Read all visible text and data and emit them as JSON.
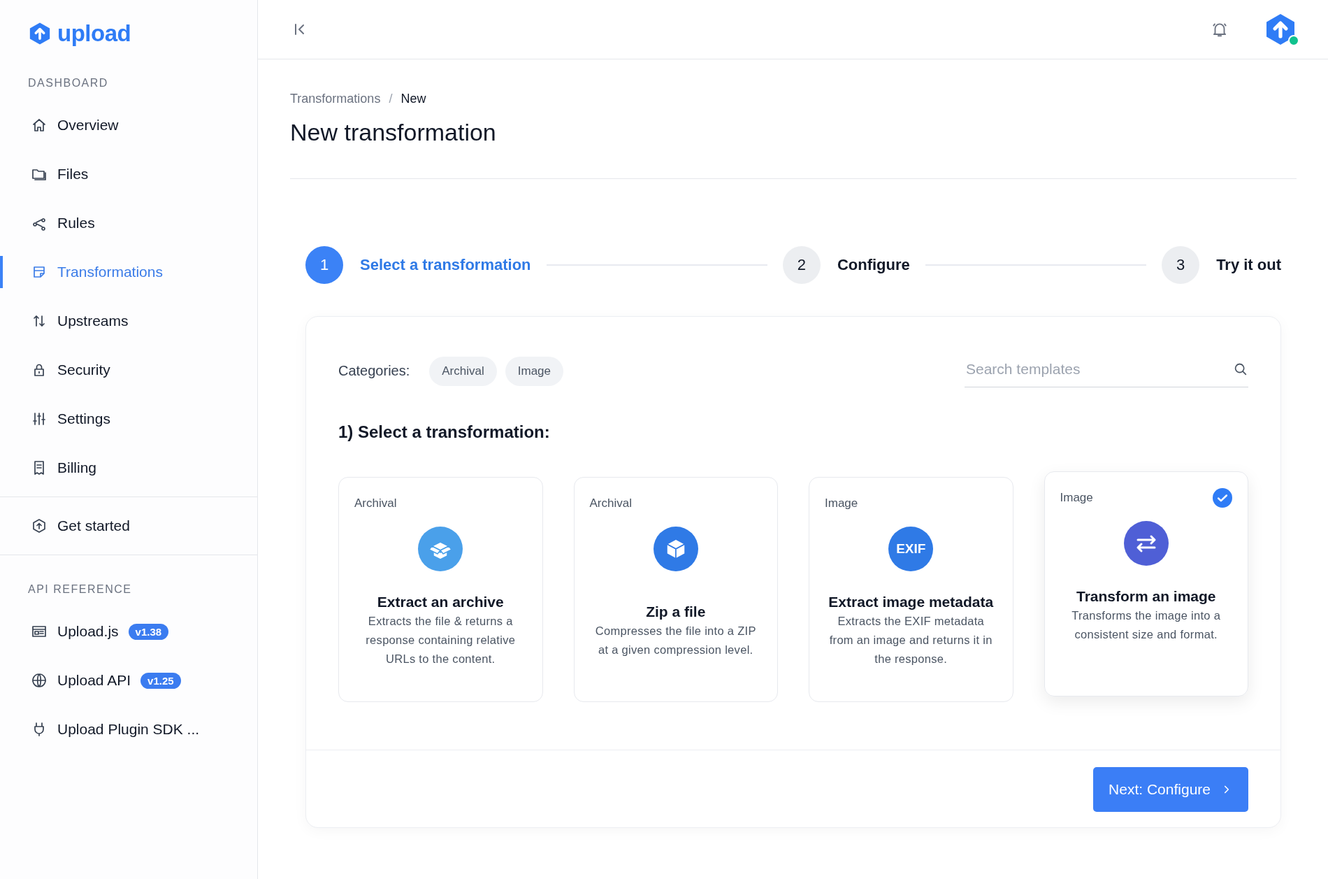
{
  "logo": {
    "text": "upload"
  },
  "sidebar": {
    "sections": [
      {
        "heading": "DASHBOARD",
        "items": [
          {
            "label": "Overview",
            "selected": false
          },
          {
            "label": "Files",
            "selected": false
          },
          {
            "label": "Rules",
            "selected": false
          },
          {
            "label": "Transformations",
            "selected": true
          },
          {
            "label": "Upstreams",
            "selected": false
          },
          {
            "label": "Security",
            "selected": false
          },
          {
            "label": "Settings",
            "selected": false
          },
          {
            "label": "Billing",
            "selected": false
          }
        ]
      },
      {
        "items": [
          {
            "label": "Get started",
            "selected": false
          }
        ]
      },
      {
        "heading": "API REFERENCE",
        "items": [
          {
            "label": "Upload.js",
            "badge": "v1.38",
            "selected": false
          },
          {
            "label": "Upload API",
            "badge": "v1.25",
            "selected": false
          },
          {
            "label": "Upload Plugin SDK ...",
            "selected": false
          }
        ]
      }
    ]
  },
  "header": {
    "avatar": {
      "online": true
    }
  },
  "breadcrumb_separator": "/",
  "breadcrumb": [
    {
      "label": "Transformations",
      "current": false
    },
    {
      "label": "New",
      "current": true
    }
  ],
  "title": "New transformation",
  "steps": [
    {
      "number": "1",
      "label": "Select a transformation",
      "selected": true
    },
    {
      "number": "2",
      "label": "Configure",
      "selected": false
    },
    {
      "number": "3",
      "label": "Try it out",
      "selected": false
    }
  ],
  "panel": {
    "categories_label": "Categories:",
    "categories": [
      "Archival",
      "Image"
    ],
    "search": {
      "placeholder": "Search templates"
    },
    "heading": "1) Select a transformation:",
    "cards": [
      {
        "category": "Archival",
        "title": "Extract an archive",
        "description": "Extracts the file & returns a response containing relative URLs to the content.",
        "selected": false
      },
      {
        "category": "Archival",
        "title": "Zip a file",
        "description": "Compresses the file into a ZIP at a given compression level.",
        "selected": false
      },
      {
        "category": "Image",
        "icon_text": "EXIF",
        "title": "Extract image metadata",
        "description": "Extracts the EXIF metadata from an image and returns it in the response.",
        "selected": false
      },
      {
        "category": "Image",
        "title": "Transform an image",
        "description": "Transforms the image into a consistent size and format.",
        "selected": true
      }
    ],
    "next_button": "Next: Configure"
  }
}
